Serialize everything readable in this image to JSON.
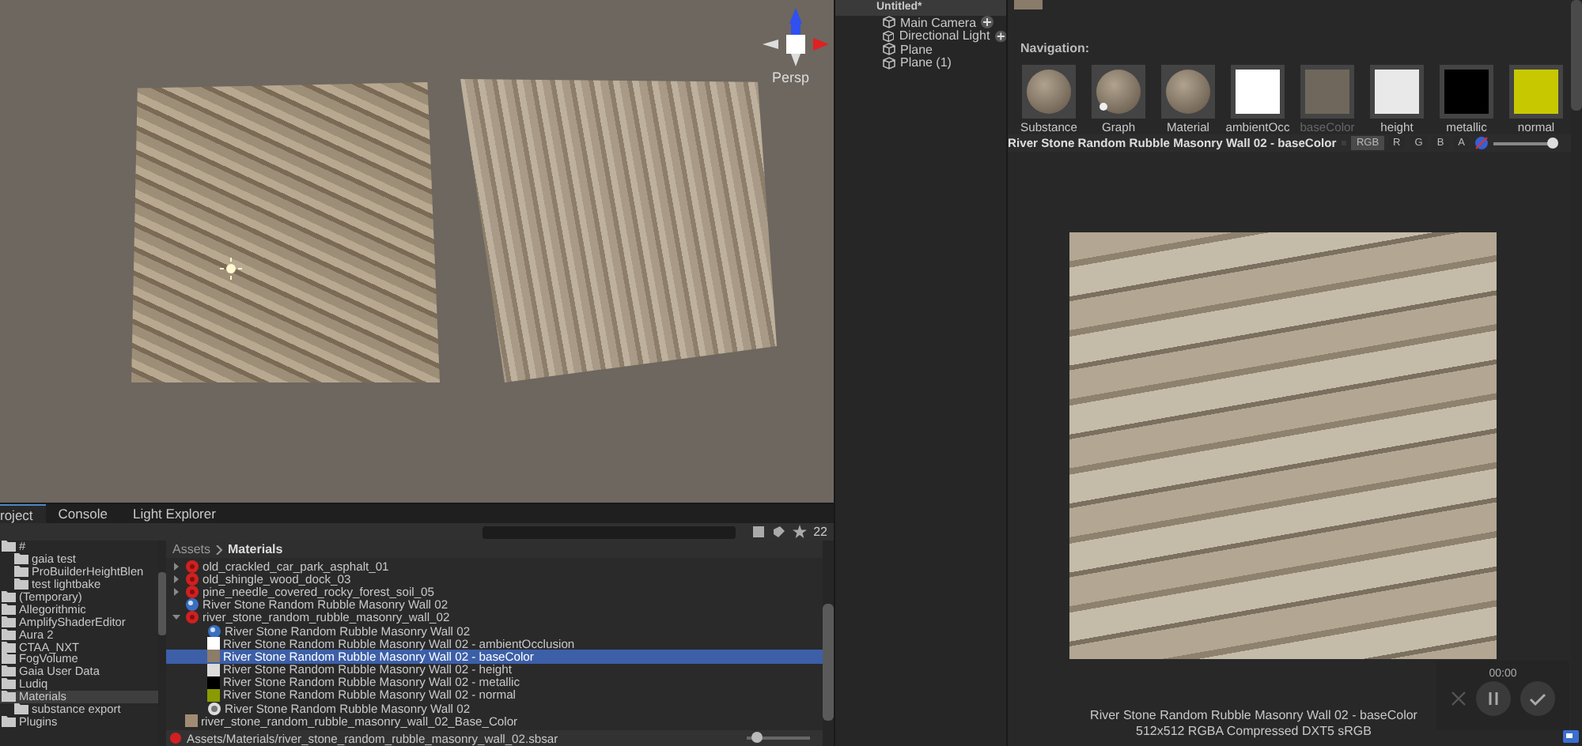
{
  "scene_view": {
    "projection": "Persp"
  },
  "hierarchy": {
    "scene": "Untitled*",
    "items": [
      {
        "label": "Main Camera",
        "has_add": true
      },
      {
        "label": "Directional Light",
        "has_add": true
      },
      {
        "label": "Plane",
        "has_add": false
      },
      {
        "label": "Plane (1)",
        "has_add": false
      }
    ]
  },
  "inspector": {
    "navigation_label": "Navigation:",
    "thumbnails": [
      {
        "label": "Substance",
        "kind": "sphere",
        "selected": false
      },
      {
        "label": "Graph",
        "kind": "graph",
        "selected": false
      },
      {
        "label": "Material",
        "kind": "sphere",
        "selected": false
      },
      {
        "label": "ambientOcc",
        "kind": "flat",
        "color": "#ffffff",
        "selected": false
      },
      {
        "label": "baseColor",
        "kind": "flat",
        "color": "#6f675c",
        "selected": true
      },
      {
        "label": "height",
        "kind": "flat",
        "color": "#e9e9e9",
        "selected": false
      },
      {
        "label": "metallic",
        "kind": "flat",
        "color": "#000000",
        "selected": false
      },
      {
        "label": "normal",
        "kind": "flat",
        "color": "#c8c800",
        "selected": false
      }
    ],
    "texture_title": "River Stone Random Rubble Masonry Wall 02 - baseColor",
    "channels": [
      {
        "label": "RGB",
        "selected": true
      },
      {
        "label": "R",
        "selected": false
      },
      {
        "label": "G",
        "selected": false
      },
      {
        "label": "B",
        "selected": false
      },
      {
        "label": "A",
        "selected": false
      }
    ],
    "mip": {
      "level": 0.93
    },
    "caption": [
      "River Stone Random Rubble Masonry Wall 02 - baseColor",
      "512x512  RGBA Compressed DXT5 sRGB"
    ]
  },
  "recorder": {
    "time": "00:00"
  },
  "project": {
    "tabs": [
      {
        "label": "roject",
        "selected": true
      },
      {
        "label": "Console",
        "selected": false
      },
      {
        "label": "Light Explorer",
        "selected": false
      }
    ],
    "search_count": "22",
    "folders": [
      {
        "label": "#",
        "selected": false,
        "children": [
          {
            "label": "gaia test",
            "selected": false
          },
          {
            "label": "ProBuilderHeightBlen",
            "selected": false
          },
          {
            "label": "test lightbake",
            "selected": false
          }
        ]
      },
      {
        "label": "(Temporary)",
        "selected": false
      },
      {
        "label": "Allegorithmic",
        "selected": false
      },
      {
        "label": "AmplifyShaderEditor",
        "selected": false
      },
      {
        "label": "Aura 2",
        "selected": false
      },
      {
        "label": "CTAA_NXT",
        "selected": false
      },
      {
        "label": "FogVolume",
        "selected": false
      },
      {
        "label": "Gaia User Data",
        "selected": false
      },
      {
        "label": "Ludiq",
        "selected": false
      },
      {
        "label": "Materials",
        "selected": true,
        "children": [
          {
            "label": "substance export",
            "selected": false
          }
        ]
      },
      {
        "label": "Plugins",
        "selected": false
      }
    ],
    "breadcrumb": [
      "Assets",
      "Materials"
    ],
    "assets": [
      {
        "label": "old_crackled_car_park_asphalt_01",
        "kind": "substance",
        "expanded": false,
        "selected": false
      },
      {
        "label": "old_shingle_wood_dock_03",
        "kind": "substance",
        "expanded": false,
        "selected": false
      },
      {
        "label": "pine_needle_covered_rocky_forest_soil_05",
        "kind": "substance",
        "expanded": false,
        "selected": false
      },
      {
        "label": "River Stone Random Rubble Masonry Wall 02",
        "kind": "material",
        "selected": false
      },
      {
        "label": "river_stone_random_rubble_masonry_wall_02",
        "kind": "substance",
        "expanded": true,
        "selected": false,
        "children": [
          {
            "label": "River Stone Random Rubble Masonry Wall 02",
            "kind": "material",
            "selected": false
          },
          {
            "label": "River Stone Random Rubble Masonry Wall 02 - ambientOcclusion",
            "kind": "texture",
            "color": "#ffffff",
            "selected": false
          },
          {
            "label": "River Stone Random Rubble Masonry Wall 02 - baseColor",
            "kind": "texture",
            "color": "#8c7c68",
            "selected": true
          },
          {
            "label": "River Stone Random Rubble Masonry Wall 02 - height",
            "kind": "texture",
            "color": "#dcdcdc",
            "selected": false
          },
          {
            "label": "River Stone Random Rubble Masonry Wall 02 - metallic",
            "kind": "texture",
            "color": "#000000",
            "selected": false
          },
          {
            "label": "River Stone Random Rubble Masonry Wall 02 - normal",
            "kind": "texture",
            "color": "#8a9a00",
            "selected": false
          },
          {
            "label": "River Stone Random Rubble Masonry Wall 02",
            "kind": "graph",
            "selected": false
          }
        ]
      },
      {
        "label": "river_stone_random_rubble_masonry_wall_02_Base_Color",
        "kind": "texture",
        "color": "#a08c74",
        "selected": false
      }
    ],
    "path": "Assets/Materials/river_stone_random_rubble_masonry_wall_02.sbsar",
    "zoom": {
      "level": 0.15
    }
  }
}
